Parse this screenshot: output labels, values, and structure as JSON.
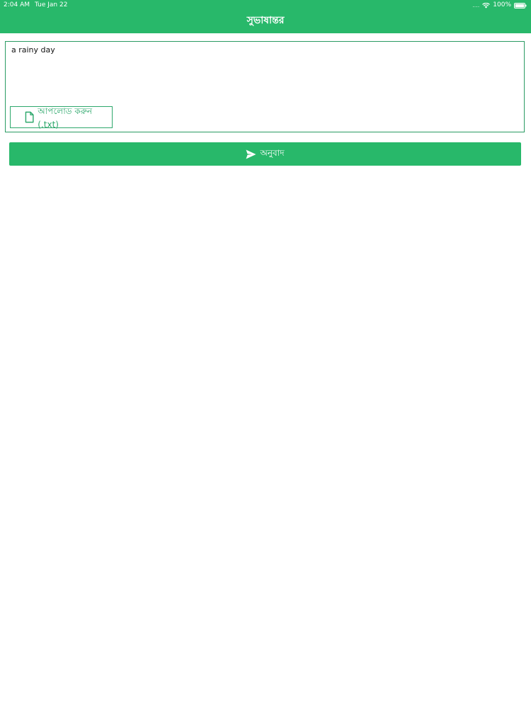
{
  "status_bar": {
    "time": "2:04 AM",
    "date": "Tue Jan 22",
    "signal": "....",
    "battery": "100%"
  },
  "header": {
    "title": "সুভাষান্তর"
  },
  "editor": {
    "text": "a rainy day"
  },
  "upload_button": {
    "label": "আপলোড করুন (.txt)",
    "icon": "file-icon"
  },
  "translate_button": {
    "label": "অনুবাদ",
    "icon": "send-icon"
  },
  "colors": {
    "accent": "#28b86a",
    "border": "#2a9b63"
  }
}
